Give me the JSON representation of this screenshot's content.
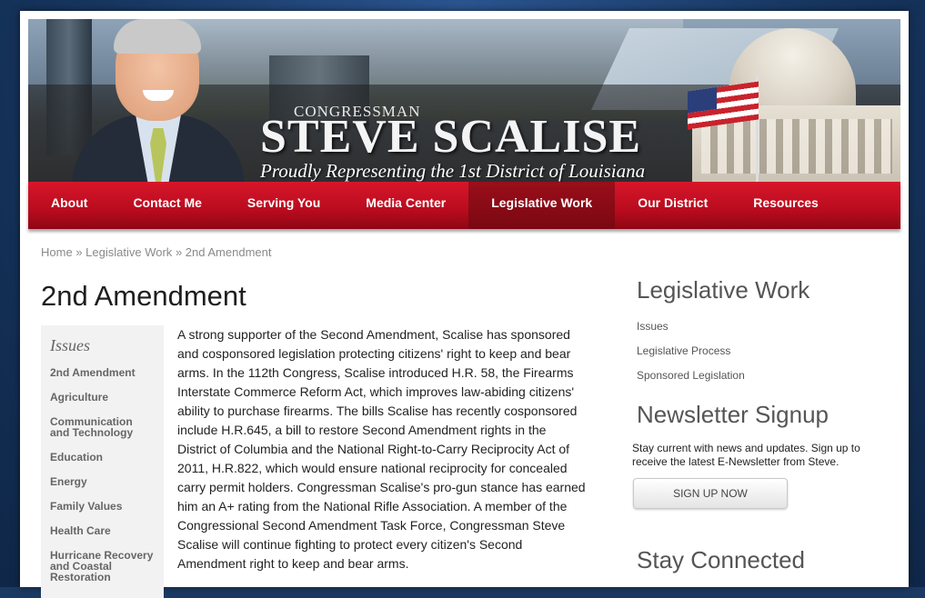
{
  "header": {
    "congressman_label": "CONGRESSMAN",
    "name": "STEVE SCALISE",
    "tagline": "Proudly Representing the 1st District of Louisiana"
  },
  "nav": {
    "items": [
      {
        "label": "About"
      },
      {
        "label": "Contact Me"
      },
      {
        "label": "Serving You"
      },
      {
        "label": "Media Center"
      },
      {
        "label": "Legislative Work",
        "active": true
      },
      {
        "label": "Our District"
      },
      {
        "label": "Resources"
      }
    ]
  },
  "breadcrumb": {
    "home": "Home",
    "sep": "»",
    "parent": "Legislative Work",
    "current": "2nd Amendment"
  },
  "main": {
    "title": "2nd Amendment",
    "body": "A strong supporter of the Second Amendment, Scalise has sponsored and cosponsored legislation protecting citizens' right to keep and bear arms. In the 112th Congress, Scalise introduced H.R. 58, the Firearms Interstate Commerce Reform Act, which improves law-abiding citizens' ability to purchase firearms. The bills Scalise has recently cosponsored include H.R.645, a bill to restore Second Amendment rights in the District of Columbia and the National Right-to-Carry Reciprocity Act of 2011, H.R.822, which would ensure national reciprocity for concealed carry permit holders. Congressman Scalise's pro-gun stance has earned him an A+ rating from the National Rifle Association. A member of the Congressional Second Amendment Task Force, Congressman Steve Scalise will continue fighting to protect every citizen's Second Amendment right to keep and bear arms."
  },
  "issues": {
    "heading": "Issues",
    "items": [
      "2nd Amendment",
      "Agriculture",
      "Communication and Technology",
      "Education",
      "Energy",
      "Family Values",
      "Health Care",
      "Hurricane Recovery and Coastal Restoration"
    ]
  },
  "sidebar": {
    "legislative_heading": "Legislative Work",
    "legislative_links": [
      "Issues",
      "Legislative Process",
      "Sponsored Legislation"
    ],
    "newsletter_heading": "Newsletter Signup",
    "newsletter_copy": "Stay current with news and updates. Sign up to receive the latest E-Newsletter from Steve.",
    "signup_label": "SIGN UP NOW",
    "connected_heading": "Stay Connected"
  },
  "colors": {
    "nav_red": "#c8102e",
    "nav_active": "#8a0a16",
    "page_bg": "#1b3a63"
  }
}
